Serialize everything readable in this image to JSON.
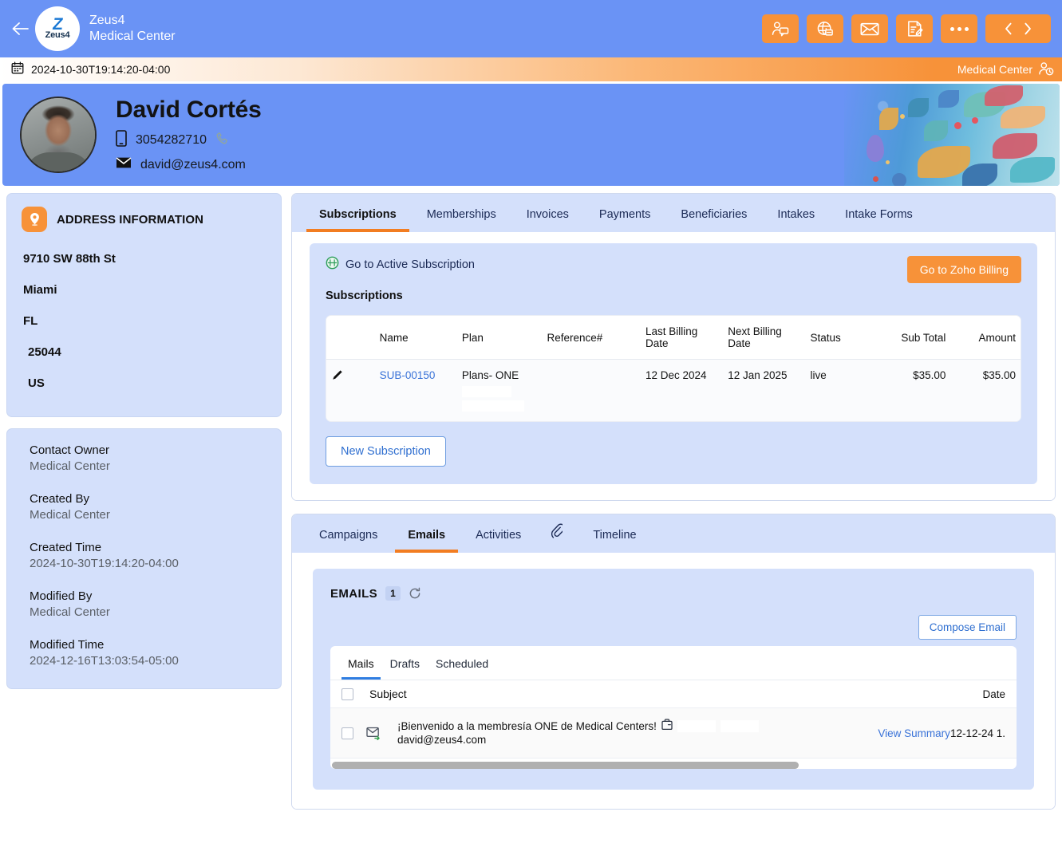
{
  "header": {
    "back_icon": "back-arrow-icon",
    "logo_glyph": "Z",
    "logo_name": "Zeus4",
    "brand_line1": "Zeus4",
    "brand_line2": "Medical Center",
    "tools": [
      {
        "name": "assign-user-icon",
        "label": ""
      },
      {
        "name": "globe-tag-icon",
        "label": ""
      },
      {
        "name": "send-email-icon",
        "label": ""
      },
      {
        "name": "edit-note-icon",
        "label": ""
      },
      {
        "name": "more-options-icon",
        "label": ""
      },
      {
        "name": "prev-next-nav",
        "label": ""
      }
    ],
    "accent_orange": "#f79239",
    "header_blue": "#6a93f5"
  },
  "datebar": {
    "calendar_icon": "calendar-icon",
    "timestamp": "2024-10-30T19:14:20-04:00",
    "owner_label": "Medical Center",
    "owner_icon": "user-clock-icon"
  },
  "profile": {
    "name": "David Cortés",
    "phone": "3054282710",
    "phone_icon": "mobile-icon",
    "call_icon": "phone-call-icon",
    "email": "david@zeus4.com",
    "email_icon": "envelope-icon"
  },
  "address": {
    "pin_icon": "location-pin-icon",
    "title": "ADDRESS INFORMATION",
    "lines": [
      "9710 SW 88th St",
      "Miami",
      "FL",
      "25044",
      "US"
    ]
  },
  "meta": [
    {
      "key": "Contact Owner",
      "value": "Medical Center"
    },
    {
      "key": "Created By",
      "value": "Medical Center"
    },
    {
      "key": "Created Time",
      "value": "2024-10-30T19:14:20-04:00"
    },
    {
      "key": "Modified By",
      "value": "Medical Center"
    },
    {
      "key": "Modified Time",
      "value": "2024-12-16T13:03:54-05:00"
    }
  ],
  "main_tabs": [
    {
      "label": "Subscriptions",
      "active": true
    },
    {
      "label": "Memberships",
      "active": false
    },
    {
      "label": "Invoices",
      "active": false
    },
    {
      "label": "Payments",
      "active": false
    },
    {
      "label": "Beneficiaries",
      "active": false
    },
    {
      "label": "Intakes",
      "active": false
    },
    {
      "label": "Intake Forms",
      "active": false
    }
  ],
  "subscriptions": {
    "active_link": "Go to Active Subscription",
    "active_link_icon": "green-circle-icon",
    "zoho_button": "Go to Zoho Billing",
    "section_label": "Subscriptions",
    "columns": [
      "",
      "Name",
      "Plan",
      "Reference#",
      "Last Billing Date",
      "Next Billing Date",
      "Status",
      "Sub Total",
      "Amount"
    ],
    "rows": [
      {
        "edit_icon": "pencil-icon",
        "name": "SUB-00150",
        "plan": "Plans- ONE",
        "reference": "",
        "last_billing_date": "12 Dec 2024",
        "next_billing_date": "12 Jan 2025",
        "status": "live",
        "sub_total": "$35.00",
        "amount": "$35.00"
      }
    ],
    "new_button": "New Subscription"
  },
  "lower_tabs": [
    {
      "label": "Campaigns",
      "active": false
    },
    {
      "label": "Emails",
      "active": true
    },
    {
      "label": "attachment-icon",
      "active": false,
      "is_icon": true
    },
    {
      "label": "Timeline",
      "active": false
    }
  ],
  "emails": {
    "title": "EMAILS",
    "count": "1",
    "refresh_icon": "refresh-icon",
    "compose_button": "Compose Email",
    "mail_tabs": [
      {
        "label": "Mails",
        "active": true
      },
      {
        "label": "Drafts",
        "active": false
      },
      {
        "label": "Scheduled",
        "active": false
      }
    ],
    "columns": {
      "subject": "Subject",
      "date": "Date"
    },
    "rows": [
      {
        "mail_icon": "mail-sent-icon",
        "attachment_icon": "attachment-card-icon",
        "subject": "¡Bienvenido a la membresía ONE de Medical Centers!",
        "from": "david@zeus4.com",
        "view_summary": "View Summary",
        "date": "12-12-24 1."
      }
    ]
  }
}
